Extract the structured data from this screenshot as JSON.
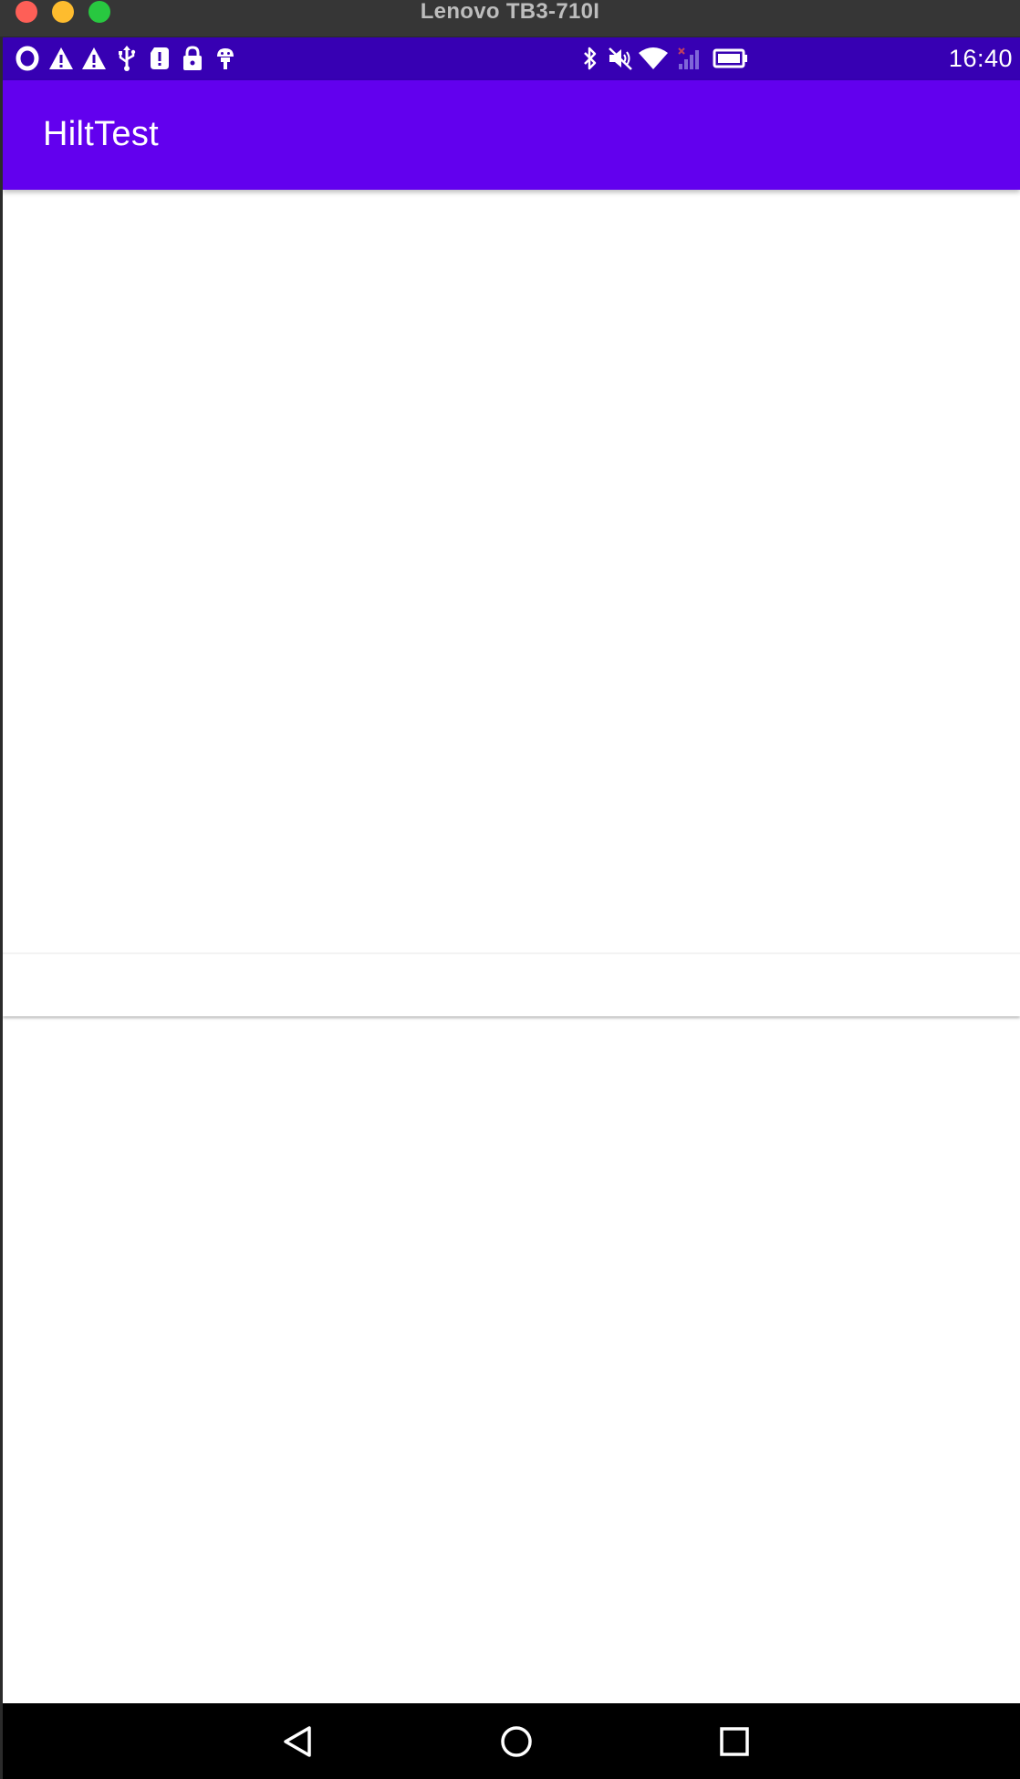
{
  "window": {
    "title": "Lenovo TB3-710I"
  },
  "status_bar": {
    "time": "16:40",
    "left_icons": [
      "opera-icon",
      "warning-icon",
      "warning-icon",
      "usb-icon",
      "alert-sim-icon",
      "lock-icon",
      "android-debug-icon"
    ],
    "right_icons": [
      "bluetooth-icon",
      "muted-icon",
      "wifi-icon",
      "signal-icon",
      "battery-icon"
    ]
  },
  "app_bar": {
    "title": "HiltTest"
  },
  "nav_bar": {
    "buttons": [
      "back-icon",
      "home-icon",
      "recents-icon"
    ]
  },
  "colors": {
    "status_bar": "#3700b3",
    "app_bar": "#6200ee",
    "background": "#ffffff",
    "nav_bar": "#000000"
  }
}
